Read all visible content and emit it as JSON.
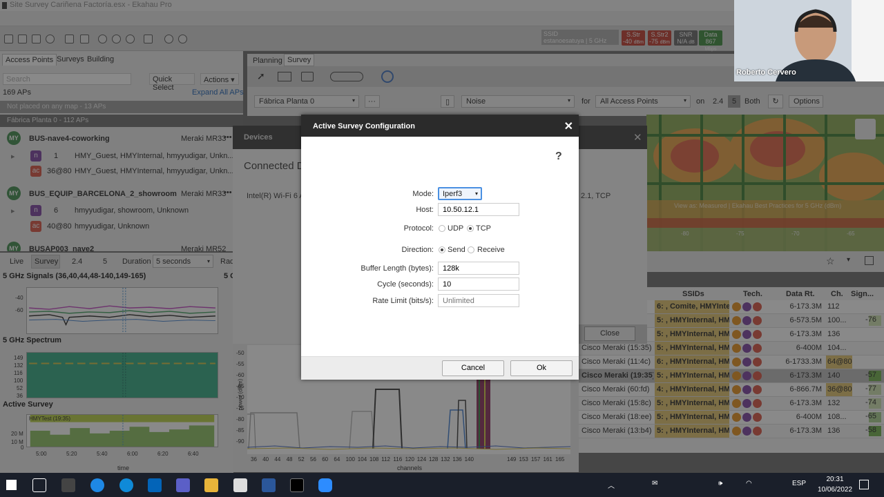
{
  "window": {
    "title": "Site Survey Cariñena Factoría.esx - Ekahau Pro"
  },
  "status_bar": {
    "ssid_label": "SSID",
    "ssid_value": "estanoesatuya | 5 GHz",
    "items": [
      {
        "label": "S.Str",
        "value": "-40",
        "unit": "dBm",
        "color": "#c0392b"
      },
      {
        "label": "S.Str2",
        "value": "-75",
        "unit": "dBm",
        "color": "#c0392b"
      },
      {
        "label": "SNR",
        "value": "N/A",
        "unit": "dB",
        "color": "#666666"
      },
      {
        "label": "Data",
        "value": "867",
        "unit": "Mbps",
        "color": "#3a8a3a"
      }
    ]
  },
  "left_tabs": [
    "Access Points",
    "Surveys",
    "Building"
  ],
  "ap_panel": {
    "search_placeholder": "Search",
    "quick_select": "Quick Select",
    "actions": "Actions",
    "ap_count": "169 APs",
    "expand_all": "Expand All APs",
    "group1": "Not placed on any map - 13 APs",
    "group2": "Fábrica Planta 0 - 112 APs",
    "aps": [
      {
        "badge": "MY",
        "name": "BUS-nave4-coworking",
        "model": "Meraki MR33",
        "radios": [
          {
            "tech": "n",
            "ch": "1",
            "ssids": "HMY_Guest, HMYInternal, hmyyudigar, Unkn..."
          },
          {
            "tech": "ac",
            "ch": "36@80",
            "ssids": "HMY_Guest, HMYInternal, hmyyudigar, Unkn..."
          }
        ]
      },
      {
        "badge": "MY",
        "name": "BUS_EQUIP_BARCELONA_2_showroom",
        "model": "Meraki MR33",
        "radios": [
          {
            "tech": "n",
            "ch": "6",
            "ssids": "hmyyudigar, showroom, Unknown"
          },
          {
            "tech": "ac",
            "ch": "40@80",
            "ssids": "hmyyudigar, Unknown"
          }
        ]
      },
      {
        "badge": "MY",
        "name": "BUSAP003_nave2",
        "model": "Meraki MR52",
        "radios": []
      }
    ]
  },
  "survey_controls": {
    "live": "Live",
    "survey": "Survey",
    "band1": "2.4",
    "band2": "5",
    "duration_label": "Duration",
    "duration_value": "5 seconds",
    "rad": "Rad"
  },
  "graphs": {
    "signals_title": "5 GHz Signals (36,40,44,48-140,149-165)",
    "signals_right": "5 G",
    "signals_ticks": [
      "-40",
      "-60"
    ],
    "spectrum_title": "5 GHz Spectrum",
    "spectrum_ticks": [
      "149",
      "132",
      "116",
      "100",
      "52",
      "36"
    ],
    "active_title": "Active Survey",
    "active_series": "HMYTest (19:35)",
    "active_ticks": [
      "20 M",
      "10 M",
      "0"
    ],
    "time_ticks": [
      "5:00",
      "5:20",
      "5:40",
      "6:00",
      "6:20",
      "6:40"
    ],
    "time_label": "time"
  },
  "planning": {
    "tabs": [
      "Planning",
      "Survey"
    ],
    "floor": "Fábrica Planta 0",
    "more": "···",
    "view": "Noise",
    "for_label": "for",
    "for_value": "All Access Points",
    "on_label": "on",
    "band_24": "2.4",
    "band_5": "5",
    "band_both": "Both",
    "options": "Options"
  },
  "map": {
    "caption": "View as: Measured | Ekahau Best Practices for 5 GHz (dBm)",
    "scale": [
      "-80",
      "-75",
      "-70",
      "-65"
    ]
  },
  "devices_dialog": {
    "title": "Devices",
    "heading": "Connected D",
    "adapter": "Intel(R) Wi-Fi 6 AX",
    "right_text": "2.1, TCP",
    "close": "Close"
  },
  "dialog": {
    "title": "Active Survey Configuration",
    "mode_label": "Mode:",
    "mode_value": "Iperf3",
    "host_label": "Host:",
    "host_value": "10.50.12.1",
    "protocol_label": "Protocol:",
    "protocol_opts": [
      "UDP",
      "TCP"
    ],
    "protocol_selected": "TCP",
    "direction_label": "Direction:",
    "direction_opts": [
      "Send",
      "Receive"
    ],
    "direction_selected": "Send",
    "buffer_label": "Buffer Length (bytes):",
    "buffer_value": "128k",
    "cycle_label": "Cycle (seconds):",
    "cycle_value": "10",
    "rate_label": "Rate Limit (bits/s):",
    "rate_placeholder": "Unlimited",
    "cancel": "Cancel",
    "ok": "Ok"
  },
  "table": {
    "headers": [
      "SSIDs",
      "Tech.",
      "Data Rt.",
      "Ch.",
      "Sign..."
    ],
    "rows": [
      {
        "name": "",
        "ssids": "6: , Comite, HMYInter...",
        "rate": "6-173.3M",
        "ch": "112",
        "sig": "",
        "sigcolor": ""
      },
      {
        "name": "",
        "ssids": "5: , HMYInternal, HM...",
        "rate": "6-573.5M",
        "ch": "100...",
        "sig": "-76",
        "sigcolor": "#cfe3b0"
      },
      {
        "name": "",
        "ssids": "5: , HMYInternal, HM...",
        "rate": "6-173.3M",
        "ch": "136",
        "sig": "",
        "sigcolor": ""
      },
      {
        "name": "Cisco Meraki (15:35)",
        "ssids": "5: , HMYInternal, HM...",
        "rate": "6-400M",
        "ch": "104...",
        "sig": "",
        "sigcolor": ""
      },
      {
        "name": "Cisco Meraki (11:4c)",
        "ssids": "6: , HMYInternal, HM...",
        "rate": "6-1733.3M",
        "ch": "64@80",
        "sig": "",
        "sigcolor": ""
      },
      {
        "name": "Cisco Meraki (19:35)",
        "ssids": "5: , HMYInternal, HM...",
        "rate": "6-173.3M",
        "ch": "140",
        "sig": "-57",
        "sigcolor": "#6fb04a"
      },
      {
        "name": "Cisco Meraki (60:fd)",
        "ssids": "4: , HMYInternal, HM...",
        "rate": "6-866.7M",
        "ch": "36@80",
        "sig": "-77",
        "sigcolor": "#cfe3b0"
      },
      {
        "name": "Cisco Meraki (15:8c)",
        "ssids": "5: , HMYInternal, HM...",
        "rate": "6-173.3M",
        "ch": "132",
        "sig": "-74",
        "sigcolor": "#cfe3b0"
      },
      {
        "name": "Cisco Meraki (18:ee)",
        "ssids": "5: , HMYInternal, HM...",
        "rate": "6-400M",
        "ch": "108...",
        "sig": "-65",
        "sigcolor": "#a9d18e"
      },
      {
        "name": "Cisco Meraki (13:b4)",
        "ssids": "5: , HMYInternal, HM...",
        "rate": "6-173.3M",
        "ch": "136",
        "sig": "-58",
        "sigcolor": "#6fb04a"
      }
    ]
  },
  "spectrum": {
    "yticks": [
      "-50",
      "-55",
      "-60",
      "-65",
      "-70",
      "-75",
      "-80",
      "-85",
      "-90"
    ],
    "ylabel": "power (dBm)",
    "xticks": [
      "36",
      "40",
      "44",
      "48",
      "52",
      "56",
      "60",
      "64",
      "100",
      "104",
      "108",
      "112",
      "116",
      "120",
      "124",
      "128",
      "132",
      "136",
      "140",
      "149",
      "153",
      "157",
      "161",
      "165"
    ],
    "xlabel": "channels"
  },
  "webcam": {
    "name": "Roberto Cervero"
  },
  "taskbar": {
    "time": "20:31",
    "date": "10/06/2022",
    "lang": "ESP"
  }
}
